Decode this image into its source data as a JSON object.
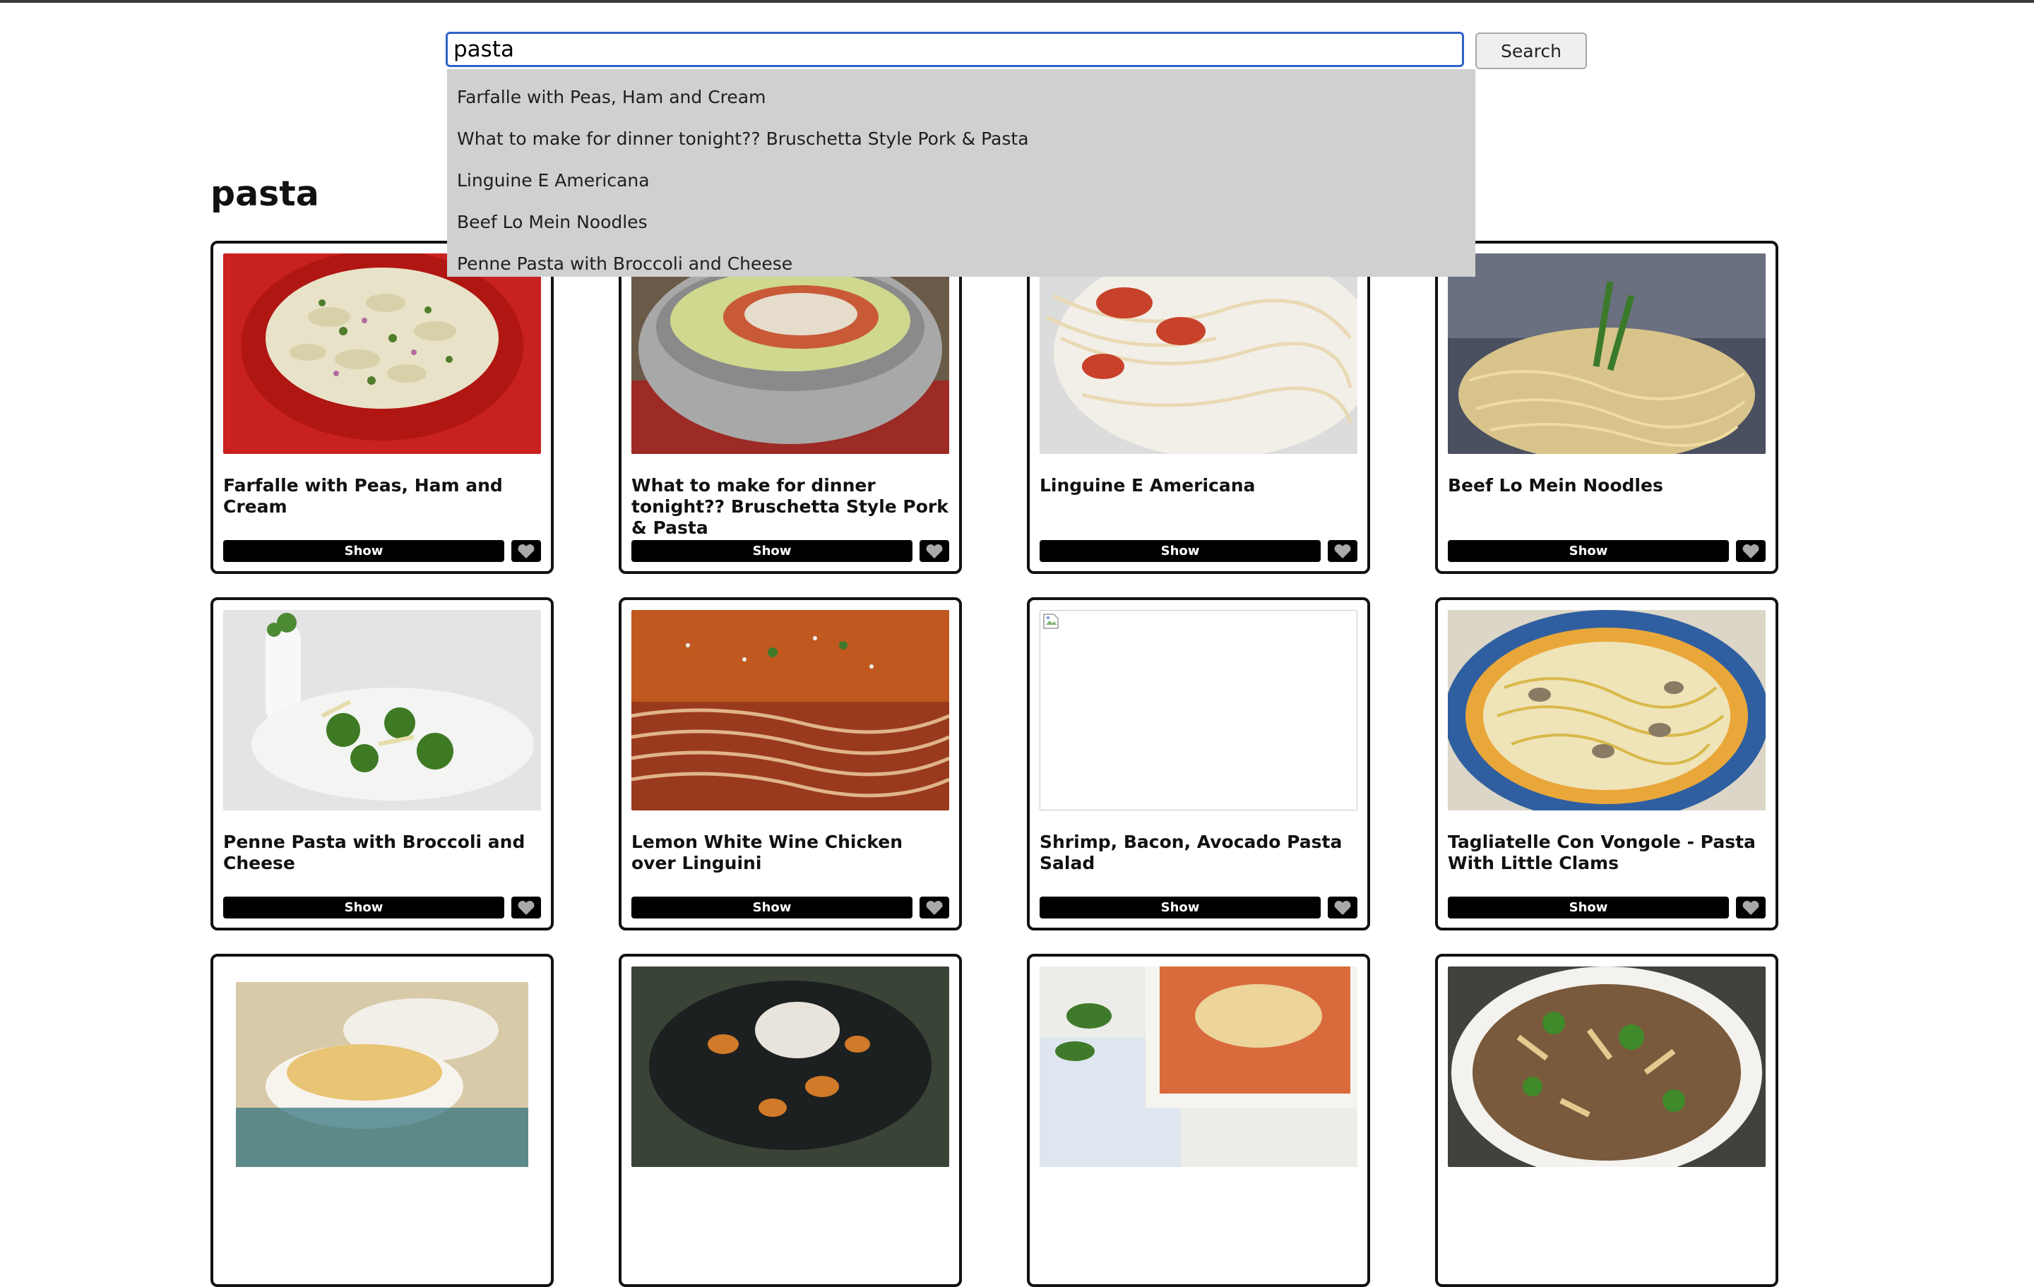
{
  "search": {
    "value": "pasta",
    "button_label": "Search"
  },
  "suggestions": [
    "Farfalle with Peas, Ham and Cream",
    "What to make for dinner tonight?? Bruschetta Style Pork & Pasta",
    "Linguine E Americana",
    "Beef Lo Mein Noodles",
    "Penne Pasta with Broccoli and Cheese"
  ],
  "results": {
    "heading": "pasta",
    "show_label": "Show",
    "cards": [
      {
        "title": "Farfalle with Peas, Ham and Cream",
        "image": "farfalle-pasta-photo"
      },
      {
        "title": "What to make for dinner tonight?? Bruschetta Style Pork & Pasta",
        "image": "bruschetta-pork-pasta-photo"
      },
      {
        "title": "Linguine E Americana",
        "image": "linguine-photo"
      },
      {
        "title": "Beef Lo Mein Noodles",
        "image": "lo-mein-noodles-photo"
      },
      {
        "title": "Penne Pasta with Broccoli and Cheese",
        "image": "penne-broccoli-photo"
      },
      {
        "title": "Lemon White Wine Chicken over Linguini",
        "image": "lemon-chicken-linguini-photo"
      },
      {
        "title": "Shrimp, Bacon, Avocado Pasta Salad",
        "image": "broken-image"
      },
      {
        "title": "Tagliatelle Con Vongole - Pasta With Little Clams",
        "image": "tagliatelle-clams-photo"
      },
      {
        "title": "",
        "image": "rigatoni-bowls-photo"
      },
      {
        "title": "",
        "image": "black-pasta-squash-photo"
      },
      {
        "title": "",
        "image": "baked-pasta-dish-photo"
      },
      {
        "title": "",
        "image": "penne-beef-broccoli-photo"
      }
    ]
  },
  "colors": {
    "button_bg": "#000000",
    "focus_border": "#2f63c9",
    "suggestion_bg": "#d0d0d0"
  }
}
